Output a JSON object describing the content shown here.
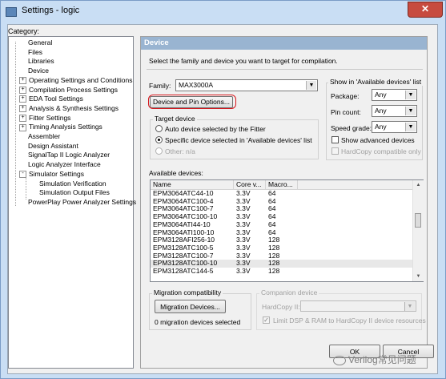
{
  "window": {
    "title": "Settings - logic",
    "close_glyph": "✕"
  },
  "category_label": "Category:",
  "tree": [
    {
      "label": "General",
      "expander": ""
    },
    {
      "label": "Files",
      "expander": ""
    },
    {
      "label": "Libraries",
      "expander": ""
    },
    {
      "label": "Device",
      "expander": ""
    },
    {
      "label": "Operating Settings and Conditions",
      "expander": "+"
    },
    {
      "label": "Compilation Process Settings",
      "expander": "+"
    },
    {
      "label": "EDA Tool Settings",
      "expander": "+"
    },
    {
      "label": "Analysis & Synthesis Settings",
      "expander": "+"
    },
    {
      "label": "Fitter Settings",
      "expander": "+"
    },
    {
      "label": "Timing Analysis Settings",
      "expander": "+"
    },
    {
      "label": "Assembler",
      "expander": ""
    },
    {
      "label": "Design Assistant",
      "expander": ""
    },
    {
      "label": "SignalTap II Logic Analyzer",
      "expander": ""
    },
    {
      "label": "Logic Analyzer Interface",
      "expander": ""
    },
    {
      "label": "Simulator Settings",
      "expander": "-"
    },
    {
      "label": "Simulation Verification",
      "expander": ""
    },
    {
      "label": "Simulation Output Files",
      "expander": ""
    },
    {
      "label": "PowerPlay Power Analyzer Settings",
      "expander": ""
    }
  ],
  "panel": {
    "header": "Device",
    "description": "Select the family and device you want to target for compilation.",
    "family_label": "Family:",
    "family_value": "MAX3000A",
    "device_pin_options_button": "Device and Pin Options...",
    "target_device": {
      "title": "Target device",
      "options": [
        {
          "label": "Auto device selected by the Fitter",
          "selected": false,
          "disabled": false
        },
        {
          "label": "Specific device selected in 'Available devices' list",
          "selected": true,
          "disabled": false
        },
        {
          "label": "Other:  n/a",
          "selected": false,
          "disabled": true
        }
      ]
    },
    "show_in": {
      "title": "Show in 'Available devices' list",
      "package_label": "Package:",
      "package_value": "Any",
      "pin_count_label": "Pin count:",
      "pin_count_value": "Any",
      "speed_grade_label": "Speed grade:",
      "speed_grade_value": "Any",
      "show_advanced_label": "Show advanced devices",
      "hardcopy_compatible_label": "HardCopy compatible only"
    },
    "available_label": "Available devices:",
    "devices_table": {
      "columns": [
        "Name",
        "Core v...",
        "Macro..."
      ],
      "rows": [
        [
          "EPM3064ATC44-10",
          "3.3V",
          "64"
        ],
        [
          "EPM3064ATC100-4",
          "3.3V",
          "64"
        ],
        [
          "EPM3064ATC100-7",
          "3.3V",
          "64"
        ],
        [
          "EPM3064ATC100-10",
          "3.3V",
          "64"
        ],
        [
          "EPM3064ATI44-10",
          "3.3V",
          "64"
        ],
        [
          "EPM3064ATI100-10",
          "3.3V",
          "64"
        ],
        [
          "EPM3128AFI256-10",
          "3.3V",
          "128"
        ],
        [
          "EPM3128ATC100-5",
          "3.3V",
          "128"
        ],
        [
          "EPM3128ATC100-7",
          "3.3V",
          "128"
        ],
        [
          "EPM3128ATC100-10",
          "3.3V",
          "128"
        ],
        [
          "EPM3128ATC144-5",
          "3.3V",
          "128"
        ]
      ],
      "selected_row": 9
    },
    "migration": {
      "title": "Migration compatibility",
      "button": "Migration Devices...",
      "status": "0 migration devices selected"
    },
    "companion": {
      "title": "Companion device",
      "hardcopy_label": "HardCopy II:",
      "hardcopy_value": "",
      "limit_label": "Limit DSP & RAM to HardCopy II device resources"
    }
  },
  "footer": {
    "ok": "OK",
    "cancel": "Cancel"
  },
  "watermark": "Verilog常见问题"
}
